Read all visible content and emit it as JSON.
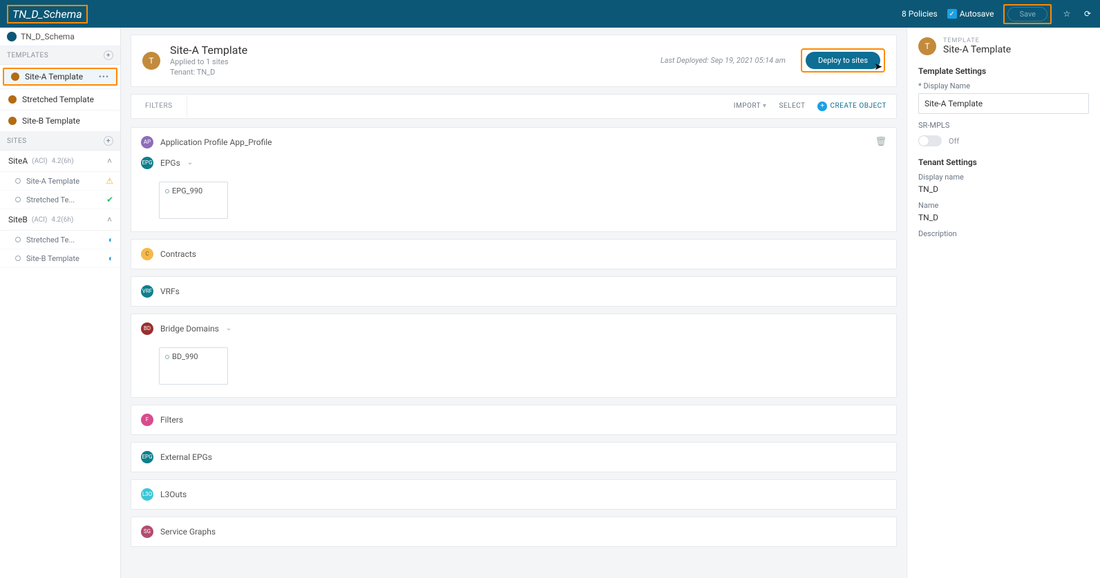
{
  "topbar": {
    "title": "TN_D_Schema",
    "policies": "8 Policies",
    "autosave": "Autosave",
    "save": "Save"
  },
  "sidebar": {
    "crumb": "TN_D_Schema",
    "templates_label": "TEMPLATES",
    "templates": [
      {
        "label": "Site-A Template"
      },
      {
        "label": "Stretched Template"
      },
      {
        "label": "Site-B Template"
      }
    ],
    "sites_label": "SITES",
    "sites": [
      {
        "name": "SiteA",
        "meta_a": "(ACI)",
        "meta_b": "4.2(6h)",
        "items": [
          {
            "label": "Site-A Template",
            "status": "warn"
          },
          {
            "label": "Stretched Te...",
            "status": "ok"
          }
        ]
      },
      {
        "name": "SiteB",
        "meta_a": "(ACI)",
        "meta_b": "4.2(6h)",
        "items": [
          {
            "label": "Stretched Te...",
            "status": "spin"
          },
          {
            "label": "Site-B Template",
            "status": "spin"
          }
        ]
      }
    ]
  },
  "main": {
    "title": "Site-A Template",
    "applied": "Applied to 1 sites",
    "tenant": "Tenant: TN_D",
    "last_deployed": "Last Deployed: Sep 19, 2021 05:14 am",
    "deploy": "Deploy to sites",
    "filters_label": "FILTERS",
    "import": "IMPORT",
    "select": "SELECT",
    "create": "CREATE OBJECT",
    "sections": {
      "app_profile": "Application Profile App_Profile",
      "epgs": "EPGs",
      "epg_card": "EPG_990",
      "contracts": "Contracts",
      "vrfs": "VRFs",
      "bds": "Bridge Domains",
      "bd_card": "BD_990",
      "filters": "Filters",
      "ext_epgs": "External EPGs",
      "l3outs": "L3Outs",
      "sgs": "Service Graphs"
    }
  },
  "rpanel": {
    "kicker": "TEMPLATE",
    "title": "Site-A Template",
    "template_settings": "Template Settings",
    "display_name_label": "* Display Name",
    "display_name_value": "Site-A Template",
    "srmpls_label": "SR-MPLS",
    "srmpls_state": "Off",
    "tenant_settings": "Tenant Settings",
    "disp_name_label": "Display name",
    "disp_name_value": "TN_D",
    "name_label": "Name",
    "name_value": "TN_D",
    "desc_label": "Description"
  }
}
